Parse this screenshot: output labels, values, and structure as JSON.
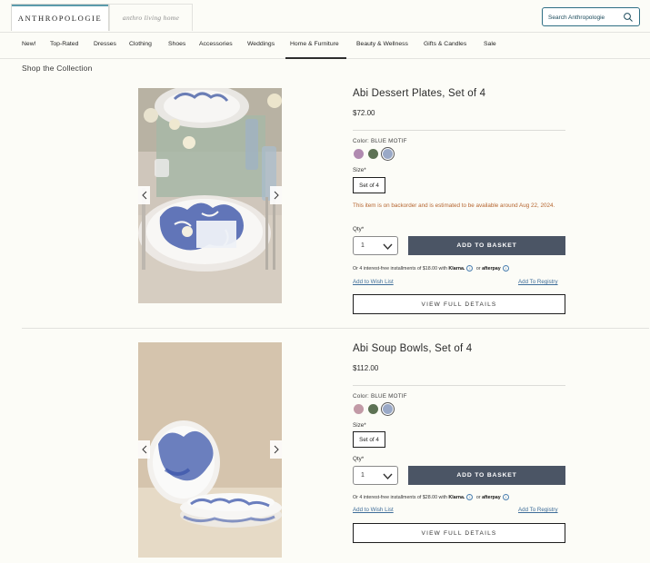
{
  "header": {
    "brand": "ANTHROPOLOGIE",
    "brand_secondary": "anthro living home",
    "search_placeholder": "Search Anthropologie"
  },
  "nav": [
    "New!",
    "Top-Rated",
    "Dresses",
    "Clothing",
    "Shoes",
    "Accessories",
    "Weddings",
    "Home & Furniture",
    "Beauty & Wellness",
    "Gifts & Candles",
    "Sale"
  ],
  "nav_active": "Home & Furniture",
  "section_title": "Shop the Collection",
  "colors": {
    "accent_teal": "#5b9bab",
    "basket_button": "#4b5565",
    "backorder_text": "#b5642e",
    "link_blue": "#3e6d99"
  },
  "products": [
    {
      "title": "Abi Dessert Plates, Set of 4",
      "price": "$72.00",
      "color_label": "Color: BLUE MOTIF",
      "swatches": [
        "#b08ab0",
        "#5d7254",
        "#9aa9c7"
      ],
      "selected_swatch": 2,
      "size_label": "Size*",
      "size_value": "Set of 4",
      "backorder": "This item is on backorder and is estimated to be available around Aug 22, 2024.",
      "qty_label": "Qty*",
      "qty_value": "1",
      "add_button": "ADD TO BASKET",
      "installments": "Or 4 interest-free installments of $18.00 with",
      "klarna": "Klarna.",
      "or": "or",
      "afterpay": "afterpay",
      "wishlist": "Add to Wish List",
      "registry": "Add To Registry",
      "details_button": "VIEW FULL DETAILS"
    },
    {
      "title": "Abi Soup Bowls, Set of 4",
      "price": "$112.00",
      "color_label": "Color: BLUE MOTIF",
      "swatches": [
        "#c29aa6",
        "#5d7254",
        "#9aa9c7"
      ],
      "selected_swatch": 2,
      "size_label": "Size*",
      "size_value": "Set of 4",
      "qty_label": "Qty*",
      "qty_value": "1",
      "add_button": "ADD TO BASKET",
      "installments": "Or 4 interest-free installments of $28.00 with",
      "klarna": "Klarna.",
      "or": "or",
      "afterpay": "afterpay",
      "wishlist": "Add to Wish List",
      "registry": "Add To Registry",
      "details_button": "VIEW FULL DETAILS"
    }
  ],
  "icons": {
    "search": "search-icon",
    "prev": "chevron-left-icon",
    "next": "chevron-right-icon",
    "qty_dropdown": "chevron-down-icon",
    "info": "info-icon"
  }
}
